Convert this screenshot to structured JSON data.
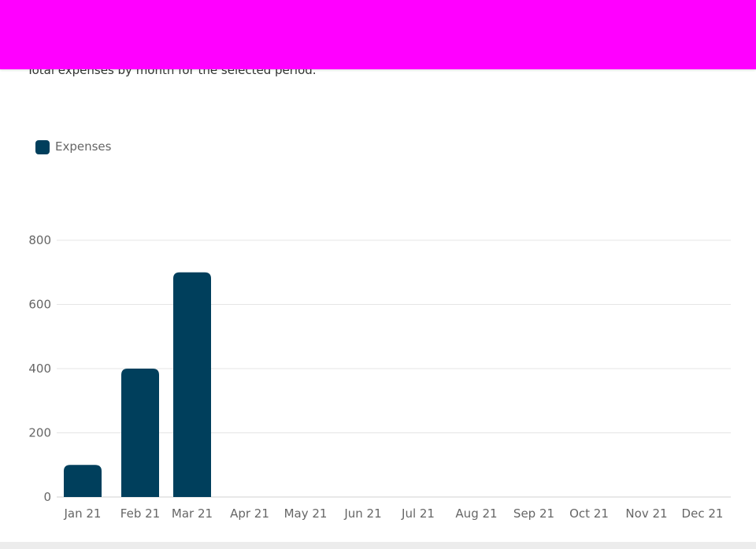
{
  "header": {
    "subtitle": "Total expenses by month for the selected period."
  },
  "colors": {
    "topbar": "#ff00ff",
    "bar": "#003f5c",
    "grid": "#e5e5e5",
    "axis_text": "#666666"
  },
  "chart_data": {
    "type": "bar",
    "categories": [
      "Jan 21",
      "Feb 21",
      "Mar 21",
      "Apr 21",
      "May 21",
      "Jun 21",
      "Jul 21",
      "Aug 21",
      "Sep 21",
      "Oct 21",
      "Nov 21",
      "Dec 21"
    ],
    "series": [
      {
        "name": "Expenses",
        "values": [
          100,
          400,
          700,
          0,
          0,
          0,
          0,
          0,
          0,
          0,
          0,
          0
        ]
      }
    ],
    "yticks": [
      0,
      200,
      400,
      600,
      800
    ],
    "ylim": [
      0,
      800
    ],
    "grid": true,
    "legend": "top-left"
  }
}
